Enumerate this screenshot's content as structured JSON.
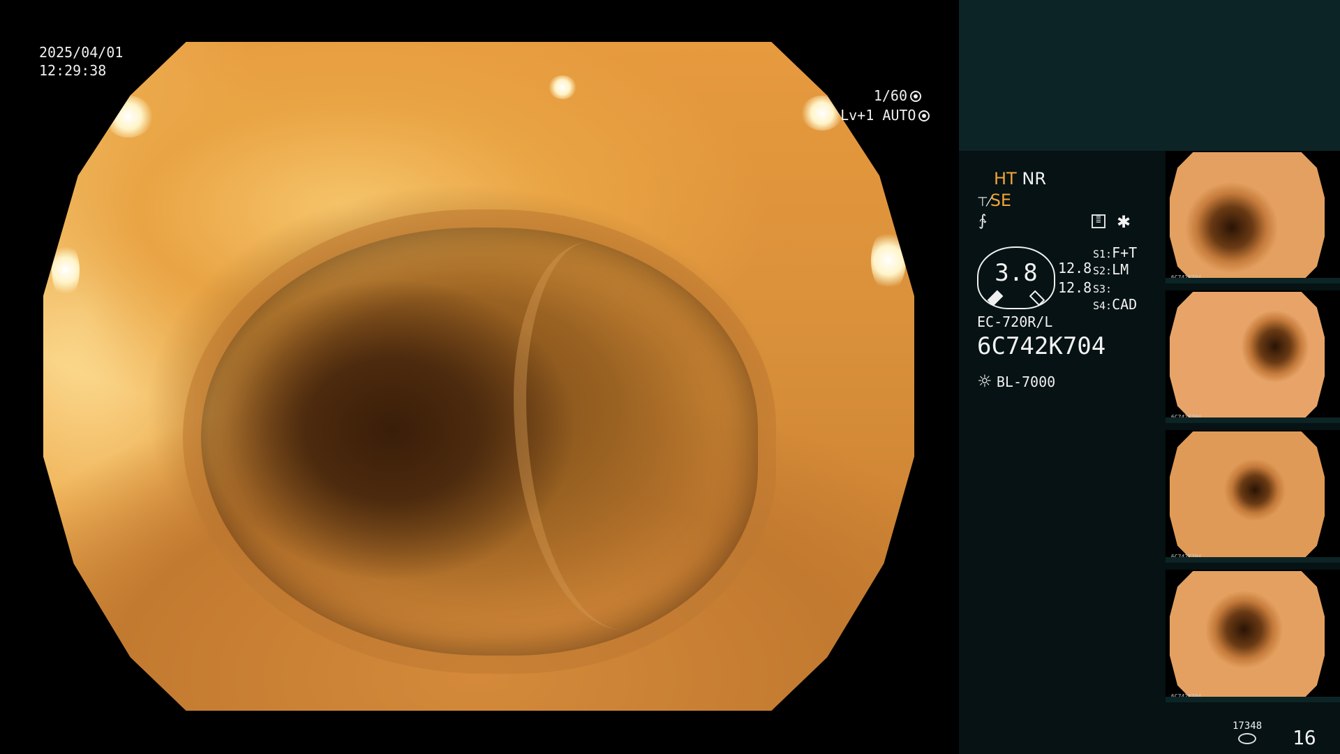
{
  "overlay": {
    "date": "2025/04/01",
    "time": "12:29:38",
    "shutter": "1/60",
    "level": "Lv+1",
    "iris": "AUTO"
  },
  "status": {
    "ht": "HT",
    "nr": "NR",
    "se": "SE",
    "gauge_value": "3.8",
    "val1": "12.8",
    "val2": "12.8",
    "s1_label": "S1:",
    "s1_value": "F+T",
    "s2_label": "S2:",
    "s2_value": "LM",
    "s3_label": "S3:",
    "s4_label": "S4:",
    "s4_value": "CAD",
    "scope_model": "EC-720R/L",
    "serial": "6C742K704",
    "light_source": "BL-7000"
  },
  "footer": {
    "count": "17348",
    "image_number": "16"
  },
  "thumbnails": [
    {
      "caption": "6C742K704"
    },
    {
      "caption": "6C742K704"
    },
    {
      "caption": "6C742K704"
    },
    {
      "caption": "6C742K704"
    }
  ],
  "colors": {
    "accent_orange": "#f0a43a",
    "panel_dark": "#061213",
    "panel_top": "#0c2426"
  },
  "icons": [
    "shutter-icon",
    "iris-icon",
    "structure-icon",
    "freeze-icon",
    "menu-icon",
    "asterisk-icon",
    "light-source-icon",
    "storage-icon"
  ]
}
